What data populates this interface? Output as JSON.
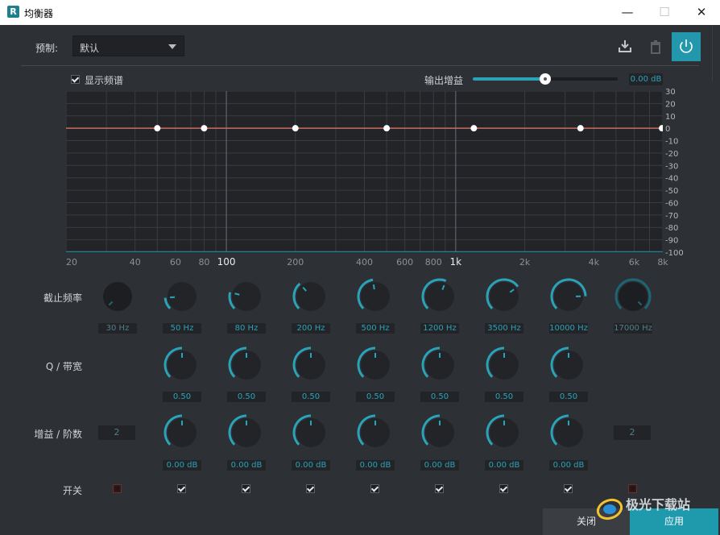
{
  "window": {
    "title": "均衡器",
    "logo_letter": "R",
    "minimize_glyph": "—",
    "maximize_glyph": "☐",
    "close_glyph": "✕"
  },
  "toolbar": {
    "preset_label": "预制:",
    "preset_value": "默认",
    "icons": [
      "download-icon",
      "trash-icon",
      "power-icon"
    ],
    "accent": "#2398ac"
  },
  "spectrum": {
    "show_label": "显示频谱",
    "show_checked": true,
    "output_gain_label": "输出增益",
    "output_gain_fraction": 0.5,
    "output_gain_value": "0.00 dB"
  },
  "chart_data": {
    "type": "line",
    "x_scale": "log",
    "xlim": [
      20,
      8000
    ],
    "ylim": [
      -100,
      30
    ],
    "y_ticks": [
      30,
      20,
      10,
      0,
      -10,
      -20,
      -30,
      -40,
      -50,
      -60,
      -70,
      -80,
      -90,
      -100
    ],
    "x_tick_labels": [
      "20",
      "40",
      "60",
      "80",
      "100",
      "200",
      "400",
      "600",
      "800",
      "1k",
      "2k",
      "4k",
      "6k",
      "8k"
    ],
    "x_ticks": [
      20,
      40,
      60,
      80,
      100,
      200,
      400,
      600,
      800,
      1000,
      2000,
      4000,
      6000,
      8000
    ],
    "bold_ticks": [
      "100",
      "1k"
    ],
    "series": [
      {
        "x": [
          20,
          50,
          80,
          200,
          500,
          1200,
          3500,
          10000,
          17000
        ],
        "y": [
          0,
          0,
          0,
          0,
          0,
          0,
          0,
          0,
          0
        ]
      }
    ],
    "control_points_x": [
      50,
      80,
      200,
      500,
      1200,
      3500,
      8000
    ],
    "line_color": "#c86c62",
    "grid": true
  },
  "bands": {
    "cutoff_label": "截止频率",
    "q_label": "Q / 带宽",
    "gain_label": "增益 / 阶数",
    "switch_label": "开关",
    "low_cut": {
      "freq": "30 Hz",
      "order": "2",
      "enabled": false,
      "level": 0.0
    },
    "high_cut": {
      "freq": "17000 Hz",
      "order": "2",
      "enabled": false,
      "level": 1.0
    },
    "items": [
      {
        "freq": "50 Hz",
        "q": "0.50",
        "gain": "0.00 dB",
        "enabled": true,
        "freq_level": 0.15
      },
      {
        "freq": "80 Hz",
        "q": "0.50",
        "gain": "0.00 dB",
        "enabled": true,
        "freq_level": 0.22
      },
      {
        "freq": "200 Hz",
        "q": "0.50",
        "gain": "0.00 dB",
        "enabled": true,
        "freq_level": 0.35
      },
      {
        "freq": "500 Hz",
        "q": "0.50",
        "gain": "0.00 dB",
        "enabled": true,
        "freq_level": 0.47
      },
      {
        "freq": "1200 Hz",
        "q": "0.50",
        "gain": "0.00 dB",
        "enabled": true,
        "freq_level": 0.58
      },
      {
        "freq": "3500 Hz",
        "q": "0.50",
        "gain": "0.00 dB",
        "enabled": true,
        "freq_level": 0.7
      },
      {
        "freq": "10000 Hz",
        "q": "0.50",
        "gain": "0.00 dB",
        "enabled": true,
        "freq_level": 0.83
      }
    ],
    "q_level": 0.5,
    "gain_level": 0.5
  },
  "footer": {
    "close_label": "关闭",
    "apply_label": "应用"
  },
  "watermark": {
    "text": "极光下载站"
  }
}
